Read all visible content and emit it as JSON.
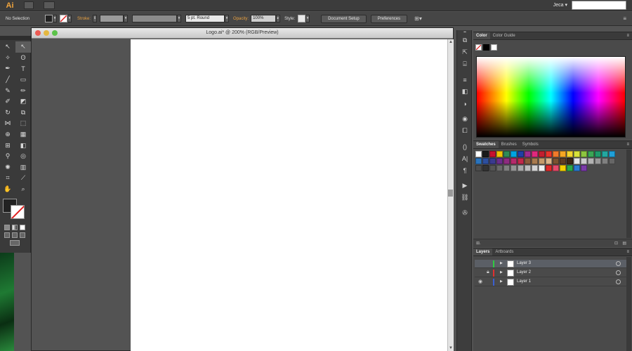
{
  "menubar": {
    "app_logo": "Ai",
    "user": "Jeca ▾",
    "search_placeholder": ""
  },
  "control_bar": {
    "selection": "No Selection",
    "stroke_label": "Stroke:",
    "brush": "5 pt. Round",
    "opacity_label": "Opacity:",
    "opacity_value": "100%",
    "style_label": "Style:",
    "document_setup": "Document Setup",
    "preferences": "Preferences"
  },
  "document": {
    "title": "Logo.ai* @ 200% (RGB/Preview)"
  },
  "color_panel": {
    "tabs": [
      "Color",
      "Color Guide"
    ]
  },
  "swatches_panel": {
    "tabs": [
      "Swatches",
      "Brushes",
      "Symbols"
    ],
    "colors": [
      "#ffffff",
      "#1a1a1a",
      "#c8102e",
      "#f2c200",
      "#2e8b57",
      "#00a3e0",
      "#1f3fa6",
      "#9b2c8f",
      "#e0287d",
      "#c21f2f",
      "#e7352c",
      "#f07a2a",
      "#f6a623",
      "#f3d42e",
      "#d8e23a",
      "#8dc63f",
      "#3aa655",
      "#1f9a6a",
      "#22a7a0",
      "#1f9fd8",
      "#2a74bd",
      "#2d4f9e",
      "#3a3a8f",
      "#6b2d8b",
      "#8e2b80",
      "#b52a6b",
      "#c0294a",
      "#8a5a3a",
      "#a87a4e",
      "#c59a6a",
      "#d9b48a",
      "#7a5230",
      "#5d3c22",
      "#3a2614",
      "#e6e6e6",
      "#cccccc",
      "#b3b3b3",
      "#999999",
      "#808080",
      "#666666",
      "#4d4d4d",
      "#333333",
      "#555555",
      "#6a6a6a",
      "#7f7f7f",
      "#949494",
      "#a9a9a9",
      "#bebebe",
      "#d3d3d3",
      "#f0f0f0",
      "#e02a2a",
      "#e54b6b",
      "#f3d000",
      "#2aa84a",
      "#2a7ad0",
      "#7a3aa8"
    ]
  },
  "layers_panel": {
    "tabs": [
      "Layers",
      "Artboards"
    ],
    "layers": [
      {
        "name": "Layer 3",
        "color": "#2ecc40"
      },
      {
        "name": "Layer 2",
        "color": "#e03030"
      },
      {
        "name": "Layer 1",
        "color": "#3a5fd0"
      }
    ]
  }
}
